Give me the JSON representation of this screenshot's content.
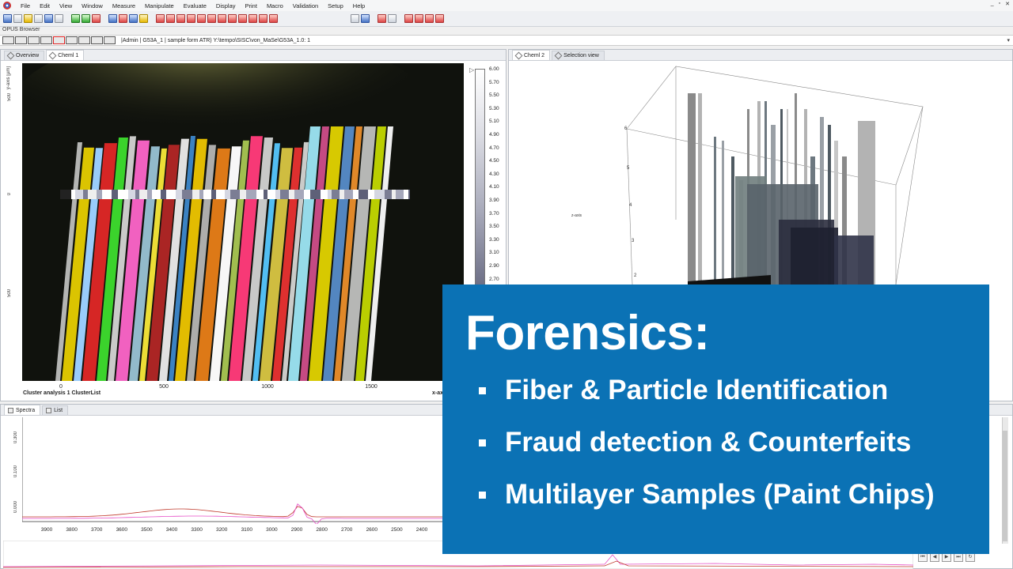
{
  "menu": {
    "items": [
      "File",
      "Edit",
      "View",
      "Window",
      "Measure",
      "Manipulate",
      "Evaluate",
      "Display",
      "Print",
      "Macro",
      "Validation",
      "Setup",
      "Help"
    ]
  },
  "browser": {
    "title": "OPUS Browser",
    "path": "|Admin | G53A_1 | sample form ATR) Y:\\tempo\\SISC\\von_MaSe\\G53A_1.0: 1"
  },
  "left_panel": {
    "tabs": [
      "Overview",
      "Cheml 1"
    ],
    "y_axis_label": "y-axis [µm]",
    "y_ticks": [
      "500",
      "0",
      "500"
    ],
    "x_ticks": [
      "0",
      "500",
      "1000",
      "1500"
    ],
    "x_axis_name": "x-axis",
    "caption": "Cluster analysis 1 ClusterList",
    "colorbar_labels": [
      "6.00",
      "5.70",
      "5.50",
      "5.30",
      "5.10",
      "4.90",
      "4.70",
      "4.50",
      "4.30",
      "4.10",
      "3.90",
      "3.70",
      "3.50",
      "3.30",
      "3.10",
      "2.90",
      "2.70"
    ]
  },
  "right_panel": {
    "tabs": [
      "Cheml 2",
      "Selection view"
    ],
    "z_axis_label": "z-axis",
    "z_ticks": [
      "6",
      "5",
      "4",
      "3",
      "2"
    ]
  },
  "spectra_panel": {
    "tabs": [
      "Spectra",
      "List"
    ],
    "y_ticks": [
      "0.300",
      "0.100",
      "0.000"
    ],
    "x_ticks": [
      "3900",
      "3800",
      "3700",
      "3600",
      "3500",
      "3400",
      "3300",
      "3200",
      "3100",
      "3000",
      "2900",
      "2800",
      "2700",
      "2600",
      "2500",
      "2400"
    ]
  },
  "overlay": {
    "title": "Forensics:",
    "bullets": [
      "Fiber & Particle Identification",
      "Fraud detection & Counterfeits",
      "Multilayer Samples (Paint Chips)"
    ]
  },
  "colors": {
    "overlay_bg": "#0b72b5",
    "spectrum_red": "#c0392b",
    "spectrum_pink": "#e64fc7"
  }
}
